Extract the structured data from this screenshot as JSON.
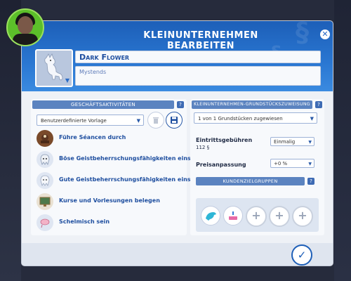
{
  "dialog": {
    "title": "Kleinunternehmen bearbeiten",
    "close_icon": "close-icon",
    "business_name": "Dark Flower",
    "business_description": "Mystends",
    "confirm_icon": "checkmark-icon"
  },
  "left": {
    "header": "Geschäftsaktivitäten",
    "help": "?",
    "template_dropdown": "Benutzerdefinierte Vorlage",
    "delete_icon": "trash-icon",
    "save_icon": "save-icon",
    "activities": [
      {
        "label": "Führe Séancen durch",
        "icon": "seance-icon"
      },
      {
        "label": "Böse Geistbeherrschungsfähigkeiten einsetzen",
        "icon": "evil-spirit-icon"
      },
      {
        "label": "Gute Geistbeherrschungsfähigkeiten einsetzen",
        "icon": "good-spirit-icon"
      },
      {
        "label": "Kurse und Vorlesungen belegen",
        "icon": "lecture-icon"
      },
      {
        "label": "Schelmisch sein",
        "icon": "mischief-icon"
      }
    ]
  },
  "right": {
    "header": "Kleinunternehmen-Grundstückszuweisung",
    "help": "?",
    "lot_dropdown": "1 von 1 Grundstücken zugewiesen",
    "entry_fee_label": "Eintrittsgebühren",
    "entry_fee_value": "112 §",
    "entry_fee_mode": "Einmalig",
    "price_adjust_label": "Preisanpassung",
    "price_adjust_value": "+0 %",
    "customer_groups_header": "Kundenzielgruppen",
    "customer_groups_help": "?",
    "customer_groups": [
      "dolphin-icon",
      "cake-icon",
      "add-icon",
      "add-icon",
      "add-icon"
    ]
  }
}
